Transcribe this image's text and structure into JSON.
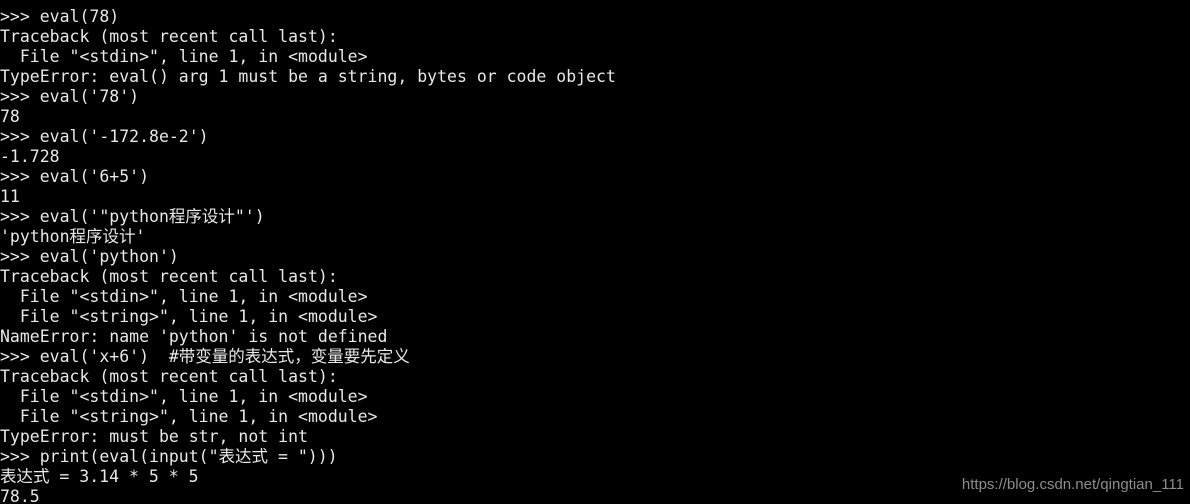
{
  "terminal": {
    "app": "Python interactive shell (IDLE / console)",
    "background_color": "#000000",
    "text_color": "#e8e8e8",
    "prompt": ">>> ",
    "font_size_px": 16.5,
    "line_height_px": 20,
    "scrolled_partial_top_line": " "
  },
  "lines": [
    {
      "text": " "
    },
    {
      "text": ">>> eval(78)"
    },
    {
      "text": "Traceback (most recent call last):"
    },
    {
      "text": "  File \"<stdin>\", line 1, in <module>"
    },
    {
      "text": "TypeError: eval() arg 1 must be a string, bytes or code object"
    },
    {
      "text": ">>> eval('78')"
    },
    {
      "text": "78"
    },
    {
      "text": ">>> eval('-172.8e-2')"
    },
    {
      "text": "-1.728"
    },
    {
      "text": ">>> eval('6+5')"
    },
    {
      "text": "11"
    },
    {
      "text": ">>> eval('\"python程序设计\"')"
    },
    {
      "text": "'python程序设计'"
    },
    {
      "text": ">>> eval('python')"
    },
    {
      "text": "Traceback (most recent call last):"
    },
    {
      "text": "  File \"<stdin>\", line 1, in <module>"
    },
    {
      "text": "  File \"<string>\", line 1, in <module>"
    },
    {
      "text": "NameError: name 'python' is not defined"
    },
    {
      "text": ">>> eval('x+6')  #带变量的表达式，变量要先定义"
    },
    {
      "text": "Traceback (most recent call last):"
    },
    {
      "text": "  File \"<stdin>\", line 1, in <module>"
    },
    {
      "text": "  File \"<string>\", line 1, in <module>"
    },
    {
      "text": "TypeError: must be str, not int"
    },
    {
      "text": ">>> print(eval(input(\"表达式 = \")))"
    },
    {
      "text": "表达式 = 3.14 * 5 * 5"
    },
    {
      "text": "78.5"
    }
  ],
  "watermark": {
    "text": "https://blog.csdn.net/qingtian_111",
    "color": "#8d8d8d"
  }
}
